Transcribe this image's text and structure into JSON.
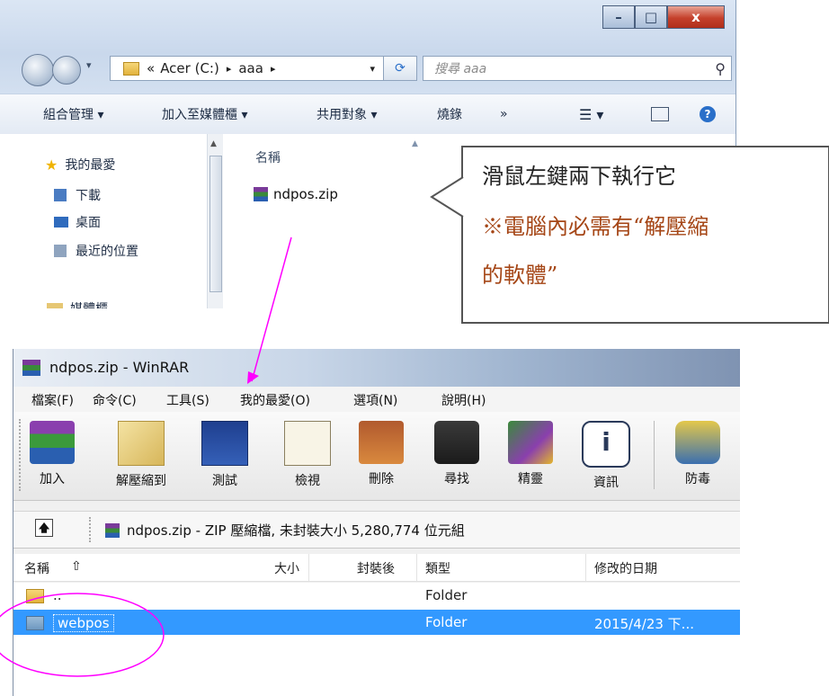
{
  "explorer": {
    "address": {
      "path_prefix": "«",
      "drive": "Acer (C:)",
      "sep1": "▸",
      "folder": "aaa",
      "sep2": "▸"
    },
    "search_placeholder": "搜尋 aaa",
    "commands": [
      "組合管理 ▾",
      "加入至媒體櫃 ▾",
      "共用對象 ▾",
      "燒錄",
      "»"
    ],
    "nav": {
      "favorites": "我的最愛",
      "downloads": "下載",
      "desktop": "桌面",
      "recent": "最近的位置",
      "libraries": "媒體櫃"
    },
    "file_header": "名稱",
    "file_name": "ndpos.zip"
  },
  "callout": {
    "line1": "滑鼠左鍵兩下執行它",
    "line2": "※電腦內必需有“解壓縮",
    "line3": "的軟體”"
  },
  "winrar": {
    "title": "ndpos.zip - WinRAR",
    "menu": [
      "檔案(F)",
      "命令(C)",
      "工具(S)",
      "我的最愛(O)",
      "選項(N)",
      "說明(H)"
    ],
    "tools": [
      "加入",
      "解壓縮到",
      "測試",
      "檢視",
      "刪除",
      "尋找",
      "精靈",
      "資訊",
      "防毒"
    ],
    "path": "ndpos.zip - ZIP 壓縮檔, 未封裝大小 5,280,774 位元組",
    "columns": {
      "name": "名稱",
      "sort": "⇧",
      "size": "大小",
      "packed": "封裝後",
      "type": "類型",
      "modified": "修改的日期"
    },
    "rows": [
      {
        "name": "..",
        "type": "Folder",
        "modified": ""
      },
      {
        "name": "webpos",
        "type": "Folder",
        "modified": "2015/4/23 下..."
      }
    ]
  },
  "colors": {
    "selection": "#3399ff",
    "callout_accent": "#a54616",
    "annotation": "#ff00ff"
  }
}
